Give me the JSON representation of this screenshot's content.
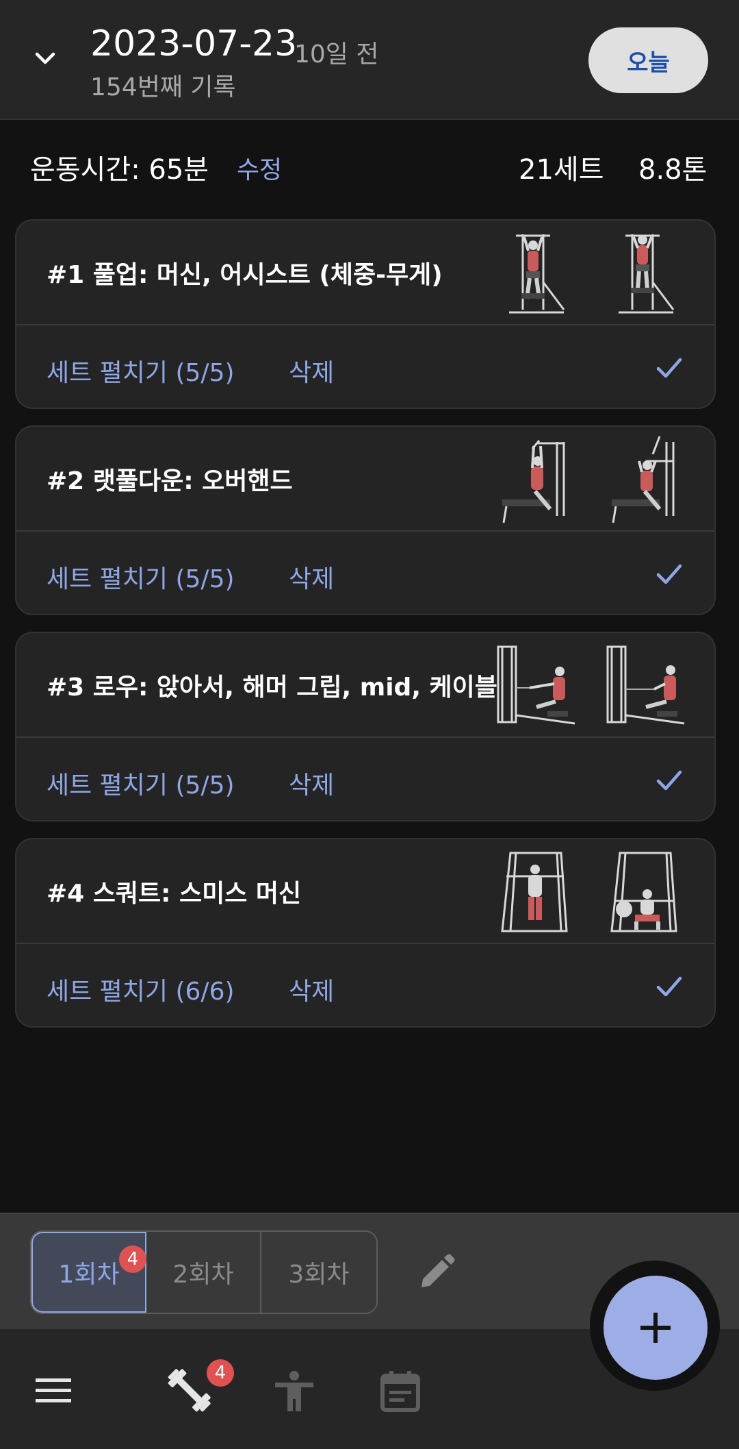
{
  "header": {
    "date": "2023-07-23",
    "days_ago": "10일 전",
    "record_count": "154번째 기록",
    "today_label": "오늘"
  },
  "summary": {
    "duration": "운동시간: 65분",
    "edit_label": "수정",
    "total_sets": "21세트",
    "total_weight": "8.8톤"
  },
  "exercises": [
    {
      "title": "#1 풀업: 머신, 어시스트 (체중-무게)",
      "expand_label": "세트 펼치기 (5/5)",
      "delete_label": "삭제",
      "thumb": "assisted-pullup-machine"
    },
    {
      "title": "#2 랫풀다운: 오버핸드",
      "expand_label": "세트 펼치기 (5/5)",
      "delete_label": "삭제",
      "thumb": "lat-pulldown"
    },
    {
      "title": "#3 로우: 앉아서, 해머 그립, mid, 케이블",
      "expand_label": "세트 펼치기 (5/5)",
      "delete_label": "삭제",
      "thumb": "seated-cable-row"
    },
    {
      "title": "#4 스쿼트: 스미스 머신",
      "expand_label": "세트 펼치기 (6/6)",
      "delete_label": "삭제",
      "thumb": "smith-squat"
    }
  ],
  "sessions": {
    "tabs": [
      "1회차",
      "2회차",
      "3회차"
    ],
    "active_index": 0,
    "active_badge": "4"
  },
  "nav": {
    "workout_badge": "4",
    "icons": [
      "menu-icon",
      "dumbbell-icon",
      "body-icon",
      "calendar-icon"
    ]
  },
  "colors": {
    "accent": "#8fa7e6",
    "fab": "#9daee6",
    "badge": "#e05252",
    "card": "#242424",
    "background": "#121212"
  }
}
